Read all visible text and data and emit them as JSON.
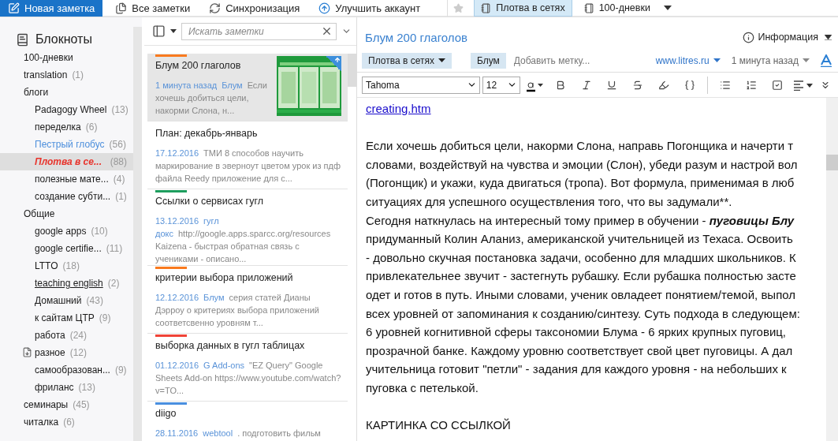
{
  "toolbar": {
    "buttons": [
      {
        "label": "Новая заметка",
        "kind": "new"
      },
      {
        "label": "Все заметки",
        "kind": "notes"
      },
      {
        "label": "Синхронизация",
        "kind": "sync"
      },
      {
        "label": "Улучшить аккаунт",
        "kind": "upgrade"
      }
    ],
    "shortcuts": [
      {
        "label": "Плотва в сетях",
        "selected": true
      },
      {
        "label": "100-дневки",
        "selected": false
      }
    ]
  },
  "sidebar": {
    "title": "Блокноты",
    "items": [
      {
        "label": "100-дневки",
        "kind": "plain",
        "selected": false
      },
      {
        "label": "translation",
        "count": "(1)",
        "kind": "plain",
        "selected": false
      },
      {
        "label": "блоги",
        "kind": "plain",
        "selected": false,
        "children": [
          {
            "label": "Padagogy Wheel",
            "count": "(13)",
            "kind": "plain",
            "selected": false
          },
          {
            "label": "переделка",
            "count": "(6)",
            "kind": "plain",
            "selected": false
          },
          {
            "label": "Пестрый глобус",
            "count": "(56)",
            "kind": "shared",
            "selected": false
          },
          {
            "label": "Плотва в се...",
            "count": "(88)",
            "kind": "plain",
            "selected": true
          },
          {
            "label": "полезные мате...",
            "count": "(4)",
            "kind": "plain",
            "selected": false
          },
          {
            "label": "создание субти...",
            "count": "(1)",
            "kind": "plain",
            "selected": false
          }
        ]
      },
      {
        "label": "Общие",
        "kind": "plain",
        "selected": false,
        "children": [
          {
            "label": "google apps",
            "count": "(10)",
            "kind": "plain",
            "selected": false
          },
          {
            "label": "google certifie...",
            "count": "(11)",
            "kind": "plain",
            "selected": false
          },
          {
            "label": "LTTO",
            "count": "(18)",
            "kind": "plain",
            "selected": false
          },
          {
            "label": "teaching english",
            "count": "(2)",
            "kind": "underlined",
            "selected": false
          },
          {
            "label": "Домашний",
            "count": "(43)",
            "kind": "plain",
            "selected": false
          },
          {
            "label": "к сайтам ЦТР",
            "count": "(9)",
            "kind": "plain",
            "selected": false
          },
          {
            "label": "работа",
            "count": "(24)",
            "kind": "plain",
            "selected": false
          },
          {
            "label": "разное",
            "count": "(12)",
            "kind": "synced",
            "selected": false
          },
          {
            "label": "самообразован...",
            "count": "(9)",
            "kind": "plain",
            "selected": false
          },
          {
            "label": "фриланс",
            "count": "(13)",
            "kind": "plain",
            "selected": false
          }
        ]
      },
      {
        "label": "семинары",
        "count": "(45)",
        "kind": "plain",
        "selected": false
      },
      {
        "label": "читалка",
        "count": "(6)",
        "kind": "plain",
        "selected": false
      }
    ]
  },
  "note_list": {
    "search": {
      "placeholder": "Искать заметки"
    },
    "notes": [
      {
        "title": "Блум 200 глаголов",
        "color": "#f97a1e",
        "date": "1 минута назад",
        "tag": "Блум",
        "snippet": "Если хочешь добиться цели, накорми Слона, н...",
        "selected": true
      },
      {
        "title": "План: декабрь-январь",
        "date": "17.12.2016",
        "snippet": "ТМИ 8 способов научить маркирование в эверноут цветом урок из пдф файла Reedy приложение для с...",
        "selected": false
      },
      {
        "title": "Ссылки о сервисах гугл",
        "color": "#1e9e5e",
        "date": "13.12.2016",
        "tag": "гугл докс",
        "snippet": "http://google.apps.sparcc.org/resources Kaizena - быстрая обратная связь с учениками - описано...",
        "selected": false
      },
      {
        "title": "критерии выбора приложений",
        "color": "#f97a1e",
        "date": "12.12.2016",
        "tag": "Блум",
        "snippet": "серия статей Дианы Дэрроу о критериях выбора приложений соответсвенно уровням т...",
        "selected": false
      },
      {
        "title": "выборка данных в гугл таблицах",
        "color": "#f04438",
        "date": "01.12.2016",
        "tag": "G Add-ons",
        "snippet": "\"EZ Query\" Google Sheets Add-on https://www.youtube.com/watch?v=TO...",
        "selected": false
      },
      {
        "title": "diigo",
        "color": "#4a8fe0",
        "date": "28.11.2016",
        "tag": "webtool",
        "snippet": ". подготовить фильм",
        "selected": false
      }
    ]
  },
  "editor": {
    "title": "Блум 200 глаголов",
    "info": "Информация",
    "notebook": "Плотва в сетях",
    "tags": [
      "Блум"
    ],
    "tag_placeholder": "Добавить метку...",
    "source": "www.litres.ru",
    "updated": "1 минута назад",
    "format": {
      "font": "Tahoma",
      "size": "12"
    },
    "blocks": [
      {
        "kind": "link",
        "lines": [
          "creating.htm"
        ]
      },
      {
        "kind": "text",
        "lines": [
          "Если хочешь добиться цели, накорми Слона, направь Погонщика и начерти т",
          "словами, воздействуй на чувства и эмоции (Слон), убеди разум и настрой вол",
          "(Погонщик) и укажи, куда двигаться (тропа). Вот формула, применимая в люб",
          "ситуациях для успешного осуществления того, что вы задумали**.",
          "Сегодня наткнулась на интересный тому пример в обучении - **пуговицы Блу**",
          "придуманный Колин Аланиз, американской учительницей из Техаса. Освоить",
          "- довольно скучная постановка задачи, особенно для младших школьников. К",
          "привлекательнее звучит - застегнуть рубашку. Если рубашка полностью засте",
          "одет и готов в путь. Иными словами, ученик овладеет понятием/темой, выпол",
          "всех уровней от запоминания к созданию/синтезу. Суть подхода в следующем:",
          "6 уровней когнитивной сферы таксономии Блума - 6 ярких крупных пуговиц,",
          "прозрачной банке. Каждому уровню соответствует свой цвет пуговицы. А дал",
          "учительница готовит \"петли\" - задания для каждого уровня - на небольших к",
          "пуговка с петелькой."
        ]
      },
      {
        "kind": "text",
        "lines": [
          "КАРТИНКА СО ССЫЛКОЙ"
        ]
      }
    ]
  }
}
